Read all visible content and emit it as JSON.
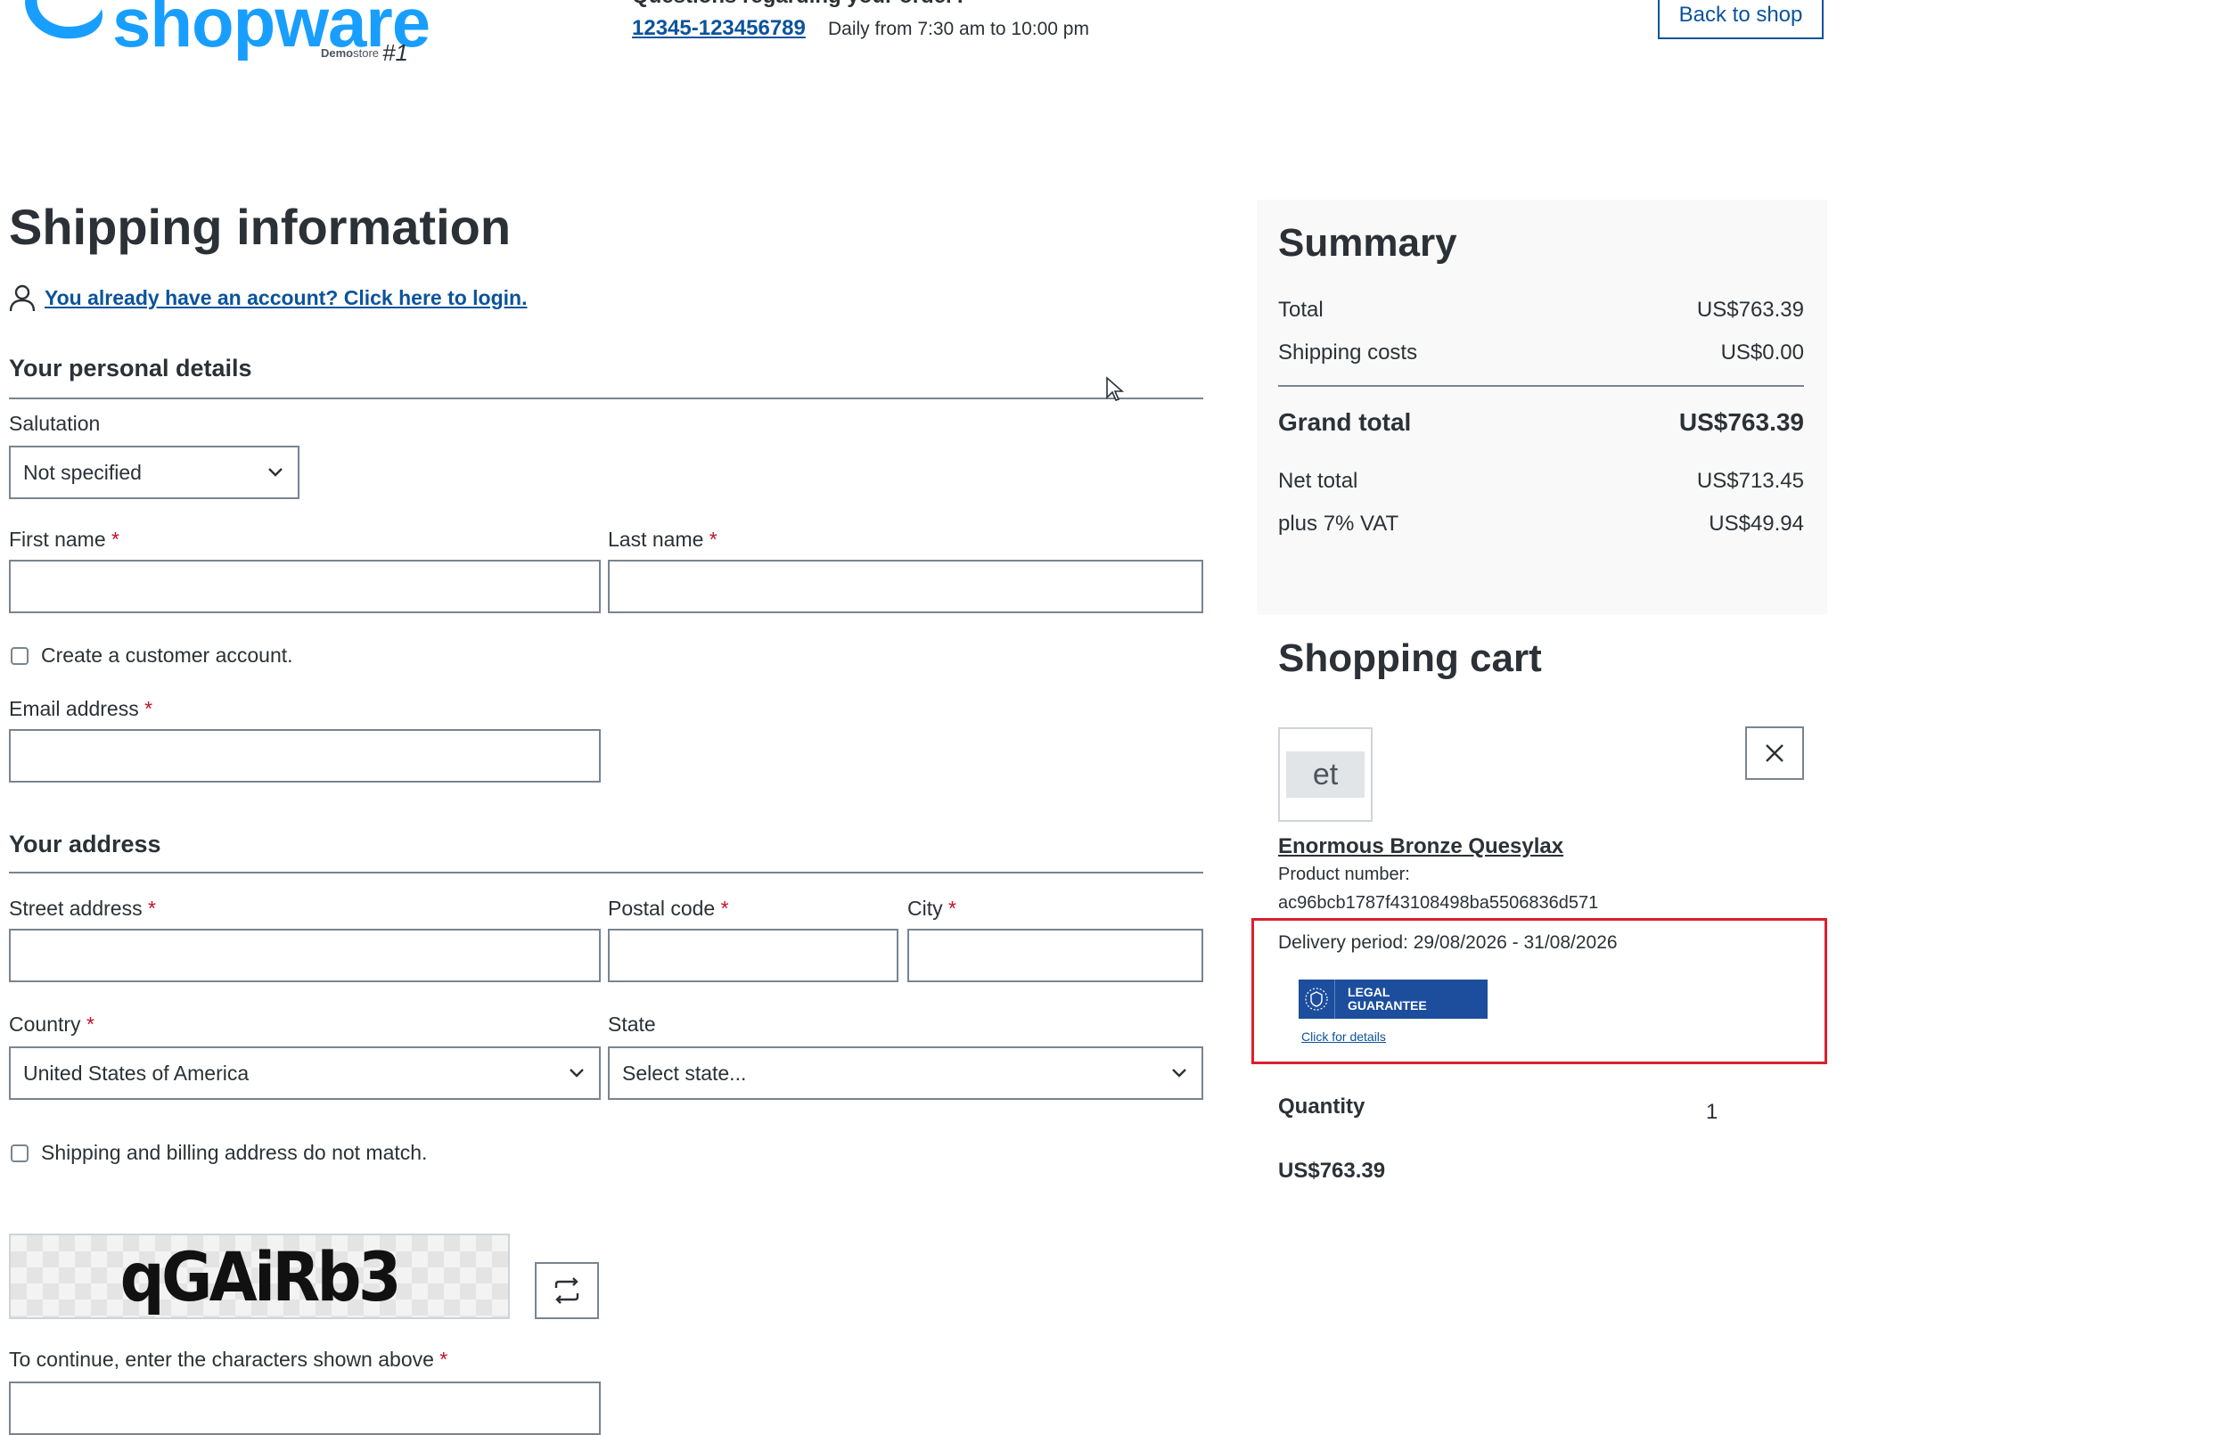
{
  "header": {
    "logo_text": "shopware",
    "logo_sub": "Demo",
    "logo_sub2": "store",
    "logo_num": "#1",
    "questions_title": "Questions regarding your order?",
    "phone": "12345-123456789",
    "hours": "Daily from 7:30 am to 10:00 pm",
    "back_label": "Back to shop"
  },
  "form": {
    "title": "Shipping information",
    "login_link": "You already have an account? Click here to login.",
    "personal_title": "Your personal details",
    "salutation_label": "Salutation",
    "salutation_value": "Not specified",
    "first_name_label": "First name",
    "last_name_label": "Last name",
    "required_mark": "*",
    "create_account_label": "Create a customer account.",
    "email_label": "Email address",
    "address_title": "Your address",
    "street_label": "Street address",
    "postal_label": "Postal code",
    "city_label": "City",
    "country_label": "Country",
    "country_value": "United States of America",
    "state_label": "State",
    "state_value": "Select state...",
    "different_billing_label": "Shipping and billing address do not match.",
    "captcha_text": "qGAiRb3",
    "captcha_instruction": "To continue, enter the characters shown above"
  },
  "summary": {
    "title": "Summary",
    "rows": [
      {
        "label": "Total",
        "value": "US$763.39"
      },
      {
        "label": "Shipping costs",
        "value": "US$0.00"
      }
    ],
    "grand_label": "Grand total",
    "grand_value": "US$763.39",
    "net_label": "Net total",
    "net_value": "US$713.45",
    "vat_label": "plus 7% VAT",
    "vat_value": "US$49.94"
  },
  "cart": {
    "title": "Shopping cart",
    "thumb_text": "et",
    "product_name": "Enormous Bronze Quesylax",
    "product_number_label": "Product number:",
    "product_number": "ac96bcb1787f43108498ba5506836d571",
    "delivery": "Delivery period: 29/08/2026 - 31/08/2026",
    "badge_line1": "LEGAL",
    "badge_line2": "GUARANTEE",
    "badge_link": "Click for details",
    "quantity_label": "Quantity",
    "quantity": "1",
    "line_total": "US$763.39"
  },
  "colors": {
    "brand": "#189eff",
    "link": "#0b539b",
    "required": "#c3102c",
    "highlight": "#d9202e"
  }
}
